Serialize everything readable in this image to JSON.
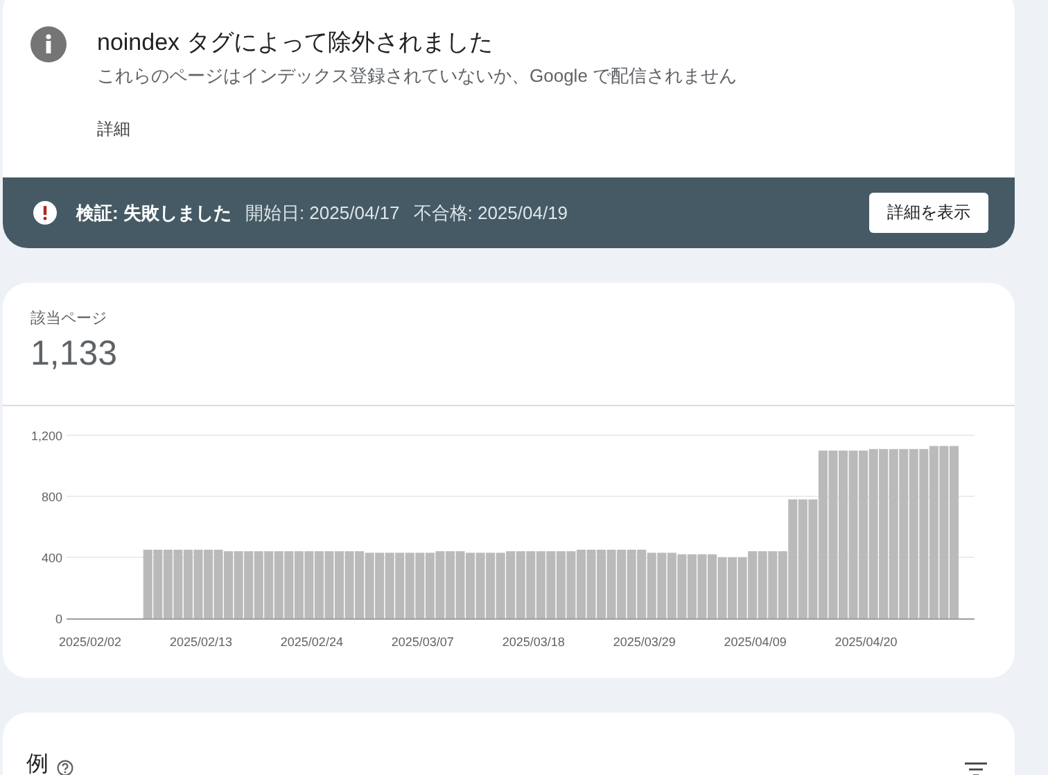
{
  "issue": {
    "title": "noindex タグによって除外されました",
    "description": "これらのページはインデックス登録されていないか、Google で配信されません",
    "link": "詳細"
  },
  "validation": {
    "status": "検証: 失敗しました",
    "started": "開始日: 2025/04/17",
    "failed": "不合格: 2025/04/19",
    "button": "詳細を表示"
  },
  "pages": {
    "label": "該当ページ",
    "count": "1,133",
    "chart_data": {
      "type": "bar",
      "categories": [
        "2025/02/02",
        null,
        null,
        null,
        null,
        null,
        null,
        null,
        null,
        null,
        null,
        "2025/02/13",
        null,
        null,
        null,
        null,
        null,
        null,
        null,
        null,
        null,
        null,
        "2025/02/24",
        null,
        null,
        null,
        null,
        null,
        null,
        null,
        null,
        null,
        null,
        "2025/03/07",
        null,
        null,
        null,
        null,
        null,
        null,
        null,
        null,
        null,
        null,
        "2025/03/18",
        null,
        null,
        null,
        null,
        null,
        null,
        null,
        null,
        null,
        null,
        "2025/03/29",
        null,
        null,
        null,
        null,
        null,
        null,
        null,
        null,
        null,
        null,
        "2025/04/09",
        null,
        null,
        null,
        null,
        null,
        null,
        null,
        null,
        null,
        null,
        "2025/04/20",
        null,
        null,
        null,
        null,
        null,
        null,
        null,
        null,
        null
      ],
      "values": [
        null,
        null,
        null,
        null,
        null,
        null,
        450,
        450,
        450,
        450,
        450,
        450,
        450,
        450,
        440,
        440,
        440,
        440,
        440,
        440,
        440,
        440,
        440,
        440,
        440,
        440,
        440,
        440,
        430,
        430,
        430,
        430,
        430,
        430,
        430,
        440,
        440,
        440,
        430,
        430,
        430,
        430,
        440,
        440,
        440,
        440,
        440,
        440,
        440,
        450,
        450,
        450,
        450,
        450,
        450,
        450,
        430,
        430,
        430,
        420,
        420,
        420,
        420,
        400,
        400,
        400,
        440,
        440,
        440,
        440,
        780,
        780,
        780,
        1100,
        1100,
        1100,
        1100,
        1100,
        1110,
        1110,
        1110,
        1110,
        1110,
        1110,
        1130,
        1130,
        1130
      ],
      "ylim": [
        0,
        1200
      ],
      "yticks": [
        {
          "value": 0,
          "label": "0"
        },
        {
          "value": 400,
          "label": "400"
        },
        {
          "value": 800,
          "label": "800"
        },
        {
          "value": 1200,
          "label": "1,200"
        }
      ]
    }
  },
  "examples": {
    "title": "例"
  }
}
